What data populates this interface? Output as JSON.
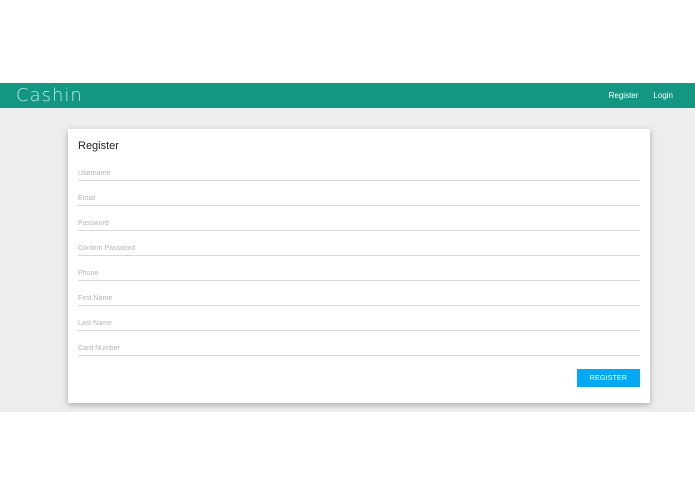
{
  "navbar": {
    "brand": "Cashin",
    "links": [
      {
        "label": "Register"
      },
      {
        "label": "Login"
      }
    ]
  },
  "form": {
    "title": "Register",
    "fields": [
      {
        "placeholder": "Username",
        "value": ""
      },
      {
        "placeholder": "Email",
        "value": ""
      },
      {
        "placeholder": "Password",
        "value": ""
      },
      {
        "placeholder": "Confirm Password",
        "value": ""
      },
      {
        "placeholder": "Phone",
        "value": ""
      },
      {
        "placeholder": "First Name",
        "value": ""
      },
      {
        "placeholder": "Last Name",
        "value": ""
      },
      {
        "placeholder": "Card Number",
        "value": ""
      }
    ],
    "submit_label": "REGISTER"
  },
  "colors": {
    "navbar": "#139783",
    "brand_text": "#b9ece3",
    "button": "#03a9f4",
    "page_background": "#ededed"
  }
}
